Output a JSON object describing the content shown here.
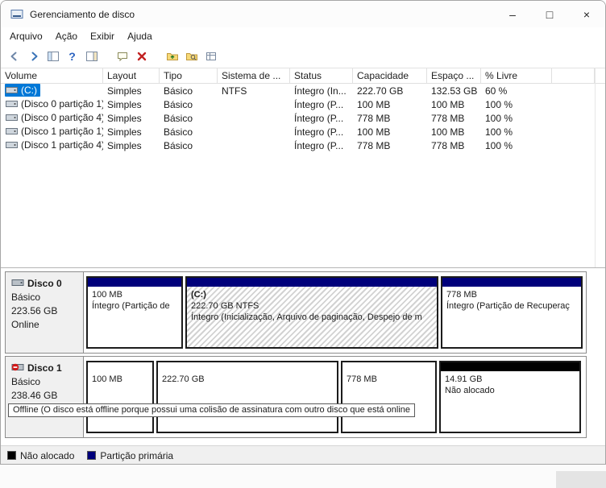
{
  "window": {
    "title": "Gerenciamento de disco",
    "controls": {
      "minimize": "–",
      "maximize": "□",
      "close": "×"
    }
  },
  "menubar": {
    "file": "Arquivo",
    "action": "Ação",
    "view": "Exibir",
    "help": "Ajuda"
  },
  "toolbar": {
    "help_glyph": "?",
    "delete_glyph": "×"
  },
  "volume_table": {
    "columns": {
      "volume": "Volume",
      "layout": "Layout",
      "tipo": "Tipo",
      "sistema": "Sistema de ...",
      "status": "Status",
      "capacidade": "Capacidade",
      "espaco": "Espaço ...",
      "livre": "% Livre"
    },
    "rows": [
      {
        "volume": "(C:)",
        "layout": "Simples",
        "tipo": "Básico",
        "sistema": "NTFS",
        "status": "Íntegro (In...",
        "capacidade": "222.70 GB",
        "espaco": "132.53 GB",
        "livre": "60 %"
      },
      {
        "volume": "(Disco 0 partição 1)",
        "layout": "Simples",
        "tipo": "Básico",
        "sistema": "",
        "status": "Íntegro (P...",
        "capacidade": "100 MB",
        "espaco": "100 MB",
        "livre": "100 %"
      },
      {
        "volume": "(Disco 0 partição 4)",
        "layout": "Simples",
        "tipo": "Básico",
        "sistema": "",
        "status": "Íntegro (P...",
        "capacidade": "778 MB",
        "espaco": "778 MB",
        "livre": "100 %"
      },
      {
        "volume": "(Disco 1 partição 1)",
        "layout": "Simples",
        "tipo": "Básico",
        "sistema": "",
        "status": "Íntegro (P...",
        "capacidade": "100 MB",
        "espaco": "100 MB",
        "livre": "100 %"
      },
      {
        "volume": "(Disco 1 partição 4)",
        "layout": "Simples",
        "tipo": "Básico",
        "sistema": "",
        "status": "Íntegro (P...",
        "capacidade": "778 MB",
        "espaco": "778 MB",
        "livre": "100 %"
      }
    ]
  },
  "disks": [
    {
      "name": "Disco 0",
      "kind": "Básico",
      "size": "223.56 GB",
      "status": "Online",
      "partitions": [
        {
          "size": "100 MB",
          "status": "Íntegro (Partição de"
        },
        {
          "label": "(C:)",
          "size": "222.70 GB NTFS",
          "status": "Íntegro (Inicialização, Arquivo de paginação, Despejo de m"
        },
        {
          "size": "778 MB",
          "status": "Íntegro (Partição de Recuperaç"
        }
      ]
    },
    {
      "name": "Disco 1",
      "kind": "Básico",
      "size": "238.46 GB",
      "tooltip": "Offline (O disco está offline porque possui uma colisão de assinatura com outro disco que está online",
      "partitions": [
        {
          "size": "100 MB"
        },
        {
          "size": "222.70 GB"
        },
        {
          "size": "778 MB"
        },
        {
          "size": "14.91 GB",
          "status": "Não alocado"
        }
      ]
    }
  ],
  "legend": {
    "unallocated": "Não alocado",
    "primary": "Partição primária"
  },
  "colors": {
    "selection": "#0078d7",
    "primary_partition": "#00007b",
    "unallocated": "#000000"
  }
}
